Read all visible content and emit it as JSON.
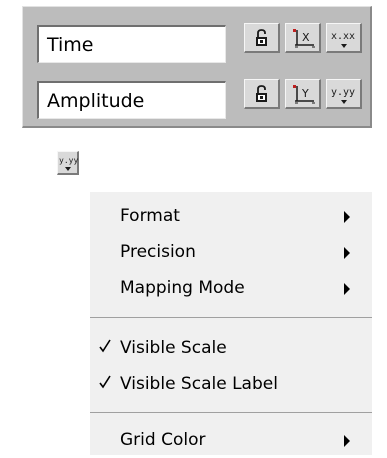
{
  "scale_legend": {
    "rows": [
      {
        "name": "Time",
        "axis_letter": "X",
        "format_text": "x.xx"
      },
      {
        "name": "Amplitude",
        "axis_letter": "Y",
        "format_text": "y.yy"
      }
    ],
    "icons": {
      "lock": "lock-icon",
      "autoscale": "autoscale-icon",
      "format": "format-icon"
    }
  },
  "popup_button": {
    "format_text": "y.yy"
  },
  "context_menu": {
    "items": [
      {
        "label": "Format",
        "submenu": true,
        "checked": false
      },
      {
        "label": "Precision",
        "submenu": true,
        "checked": false
      },
      {
        "label": "Mapping Mode",
        "submenu": true,
        "checked": false
      },
      {
        "label": "Visible Scale",
        "submenu": false,
        "checked": true
      },
      {
        "label": "Visible Scale Label",
        "submenu": false,
        "checked": true
      },
      {
        "label": "Grid Color",
        "submenu": true,
        "checked": false
      }
    ]
  },
  "colors": {
    "panel": "#bcbcbc",
    "button_face": "#d9d9d9",
    "menu_bg": "#f0f0f0",
    "separator": "#a0a0a0"
  }
}
